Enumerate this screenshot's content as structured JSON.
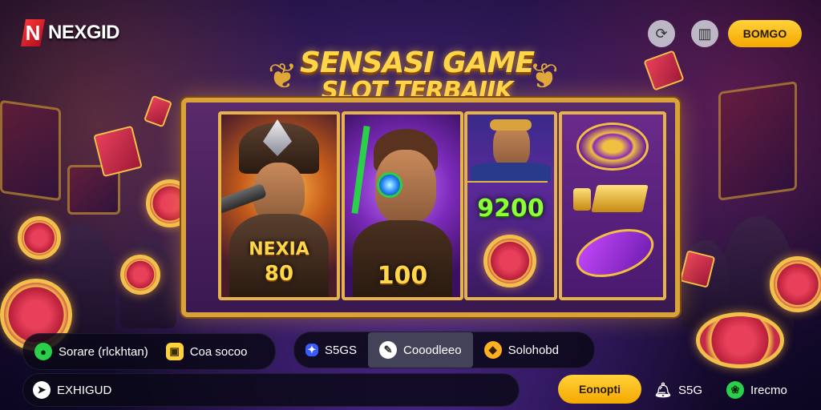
{
  "brand": {
    "name": "NEXGID",
    "mark": "N"
  },
  "header": {
    "icon1": "refresh-icon",
    "icon2": "gift-icon",
    "action_label": "BOMGO"
  },
  "title": {
    "line1": "SENSASI GAME",
    "line2": "SLOT TERBAIIK"
  },
  "reels": {
    "reel1_label_top": "NEXIA",
    "reel1_label_bottom": "80",
    "reel2_label": "100",
    "reel3_value": "9200"
  },
  "bottom_left": {
    "item1": "Sorare (rlckhtan)",
    "item2": "Coa socoo"
  },
  "bottom_mid": {
    "item1": "S5GS",
    "item2": "Cooodleeo",
    "item3": "Solohobd"
  },
  "bottom_bar": {
    "label": "EXHIGUD"
  },
  "bottom_right": {
    "button": "Eonopti",
    "item1": "S5G",
    "item2": "Irecmo"
  },
  "colors": {
    "accent": "#ffd23a",
    "frame": "#d9a23a",
    "green": "#8aff3a"
  }
}
